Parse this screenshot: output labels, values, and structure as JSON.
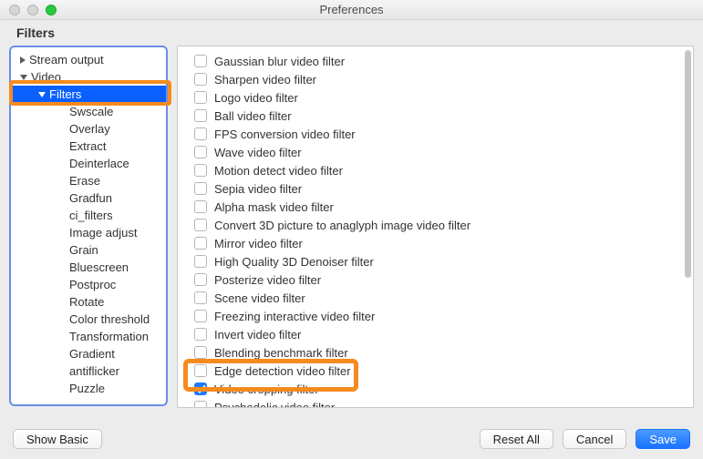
{
  "window": {
    "title": "Preferences"
  },
  "section_title": "Filters",
  "sidebar": {
    "items": [
      {
        "label": "Stream output",
        "level": 0,
        "expandable": true,
        "expanded": false,
        "selected": false
      },
      {
        "label": "Video",
        "level": 0,
        "expandable": true,
        "expanded": true,
        "selected": false
      },
      {
        "label": "Filters",
        "level": 1,
        "expandable": true,
        "expanded": true,
        "selected": true
      },
      {
        "label": "Swscale",
        "level": 2,
        "expandable": false,
        "expanded": false,
        "selected": false
      },
      {
        "label": "Overlay",
        "level": 2,
        "expandable": false,
        "expanded": false,
        "selected": false
      },
      {
        "label": "Extract",
        "level": 2,
        "expandable": false,
        "expanded": false,
        "selected": false
      },
      {
        "label": "Deinterlace",
        "level": 2,
        "expandable": false,
        "expanded": false,
        "selected": false
      },
      {
        "label": "Erase",
        "level": 2,
        "expandable": false,
        "expanded": false,
        "selected": false
      },
      {
        "label": "Gradfun",
        "level": 2,
        "expandable": false,
        "expanded": false,
        "selected": false
      },
      {
        "label": "ci_filters",
        "level": 2,
        "expandable": false,
        "expanded": false,
        "selected": false
      },
      {
        "label": "Image adjust",
        "level": 2,
        "expandable": false,
        "expanded": false,
        "selected": false
      },
      {
        "label": "Grain",
        "level": 2,
        "expandable": false,
        "expanded": false,
        "selected": false
      },
      {
        "label": "Bluescreen",
        "level": 2,
        "expandable": false,
        "expanded": false,
        "selected": false
      },
      {
        "label": "Postproc",
        "level": 2,
        "expandable": false,
        "expanded": false,
        "selected": false
      },
      {
        "label": "Rotate",
        "level": 2,
        "expandable": false,
        "expanded": false,
        "selected": false
      },
      {
        "label": "Color threshold",
        "level": 2,
        "expandable": false,
        "expanded": false,
        "selected": false
      },
      {
        "label": "Transformation",
        "level": 2,
        "expandable": false,
        "expanded": false,
        "selected": false
      },
      {
        "label": "Gradient",
        "level": 2,
        "expandable": false,
        "expanded": false,
        "selected": false
      },
      {
        "label": "antiflicker",
        "level": 2,
        "expandable": false,
        "expanded": false,
        "selected": false
      },
      {
        "label": "Puzzle",
        "level": 2,
        "expandable": false,
        "expanded": false,
        "selected": false
      }
    ]
  },
  "filters": [
    {
      "label": "Gaussian blur video filter",
      "checked": false
    },
    {
      "label": "Sharpen video filter",
      "checked": false
    },
    {
      "label": "Logo video filter",
      "checked": false
    },
    {
      "label": "Ball video filter",
      "checked": false
    },
    {
      "label": "FPS conversion video filter",
      "checked": false
    },
    {
      "label": "Wave video filter",
      "checked": false
    },
    {
      "label": "Motion detect video filter",
      "checked": false
    },
    {
      "label": "Sepia video filter",
      "checked": false
    },
    {
      "label": "Alpha mask video filter",
      "checked": false
    },
    {
      "label": "Convert 3D picture to anaglyph image video filter",
      "checked": false
    },
    {
      "label": "Mirror video filter",
      "checked": false
    },
    {
      "label": "High Quality 3D Denoiser filter",
      "checked": false
    },
    {
      "label": "Posterize video filter",
      "checked": false
    },
    {
      "label": "Scene video filter",
      "checked": false
    },
    {
      "label": "Freezing interactive video filter",
      "checked": false
    },
    {
      "label": "Invert video filter",
      "checked": false
    },
    {
      "label": "Blending benchmark filter",
      "checked": false
    },
    {
      "label": "Edge detection video filter",
      "checked": false
    },
    {
      "label": "Video cropping filter",
      "checked": true
    },
    {
      "label": "Psychedelic video filter",
      "checked": false
    }
  ],
  "buttons": {
    "show_basic": "Show Basic",
    "reset_all": "Reset All",
    "cancel": "Cancel",
    "save": "Save"
  },
  "highlights": {
    "sidebar_box_color": "#6a8fe8",
    "orange_color": "#f58b1f"
  }
}
